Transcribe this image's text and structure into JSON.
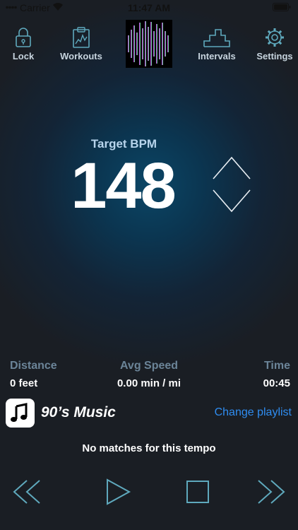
{
  "status_bar": {
    "carrier": "Carrier",
    "time": "11:47 AM"
  },
  "nav": {
    "lock": {
      "label": "Lock",
      "icon": "lock-icon"
    },
    "workouts": {
      "label": "Workouts",
      "icon": "clipboard-chart-icon"
    },
    "spectrum": {
      "icon": "equalizer-spectrum-icon"
    },
    "intervals": {
      "label": "Intervals",
      "icon": "stairs-icon"
    },
    "settings": {
      "label": "Settings",
      "icon": "gear-icon"
    }
  },
  "bpm": {
    "label": "Target BPM",
    "value": "148"
  },
  "stats": {
    "distance": {
      "label": "Distance",
      "value": "0 feet"
    },
    "avg_speed": {
      "label": "Avg Speed",
      "value": "0.00 min / mi"
    },
    "time": {
      "label": "Time",
      "value": "00:45"
    }
  },
  "playlist": {
    "name": "90’s Music",
    "change_label": "Change playlist"
  },
  "match_status": "No matches for this tempo",
  "controls": [
    "rewind-icon",
    "play-icon",
    "stop-icon",
    "fast-forward-icon"
  ],
  "colors": {
    "accent": "#2f8df1",
    "icon_outline": "#5fa9bd",
    "label_muted": "#6b8498",
    "bpm_label": "#b7d4ec"
  }
}
